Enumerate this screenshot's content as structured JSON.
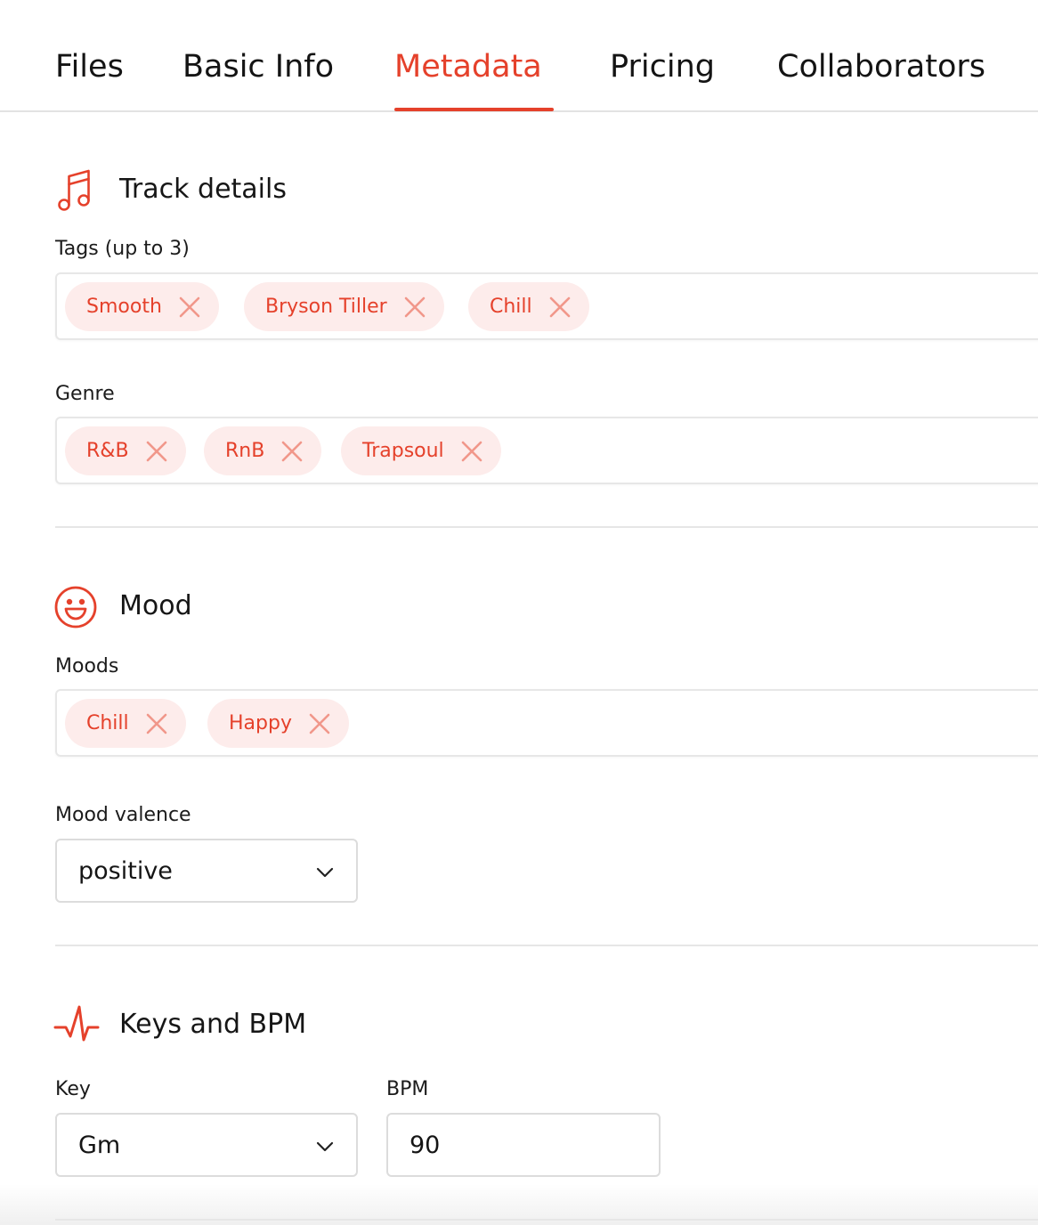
{
  "tabs": [
    "Files",
    "Basic Info",
    "Metadata",
    "Pricing",
    "Collaborators"
  ],
  "active_tab": "Metadata",
  "track_details": {
    "title": "Track details",
    "tags_label": "Tags (up to 3)",
    "tags": [
      "Smooth",
      "Bryson Tiller",
      "Chill"
    ],
    "genre_label": "Genre",
    "genres": [
      "R&B",
      "RnB",
      "Trapsoul"
    ]
  },
  "mood": {
    "title": "Mood",
    "moods_label": "Moods",
    "moods": [
      "Chill",
      "Happy"
    ],
    "valence_label": "Mood valence",
    "valence_value": "positive"
  },
  "keys_bpm": {
    "title": "Keys and BPM",
    "key_label": "Key",
    "key_value": "Gm",
    "bpm_label": "BPM",
    "bpm_value": "90"
  },
  "icons": {
    "track": "music-note-icon",
    "mood": "smiley-face-icon",
    "keys": "pulse-icon",
    "remove": "close-icon",
    "dropdown": "chevron-down-icon"
  },
  "colors": {
    "accent": "#e5412b",
    "chip_bg": "#fdeceb"
  }
}
